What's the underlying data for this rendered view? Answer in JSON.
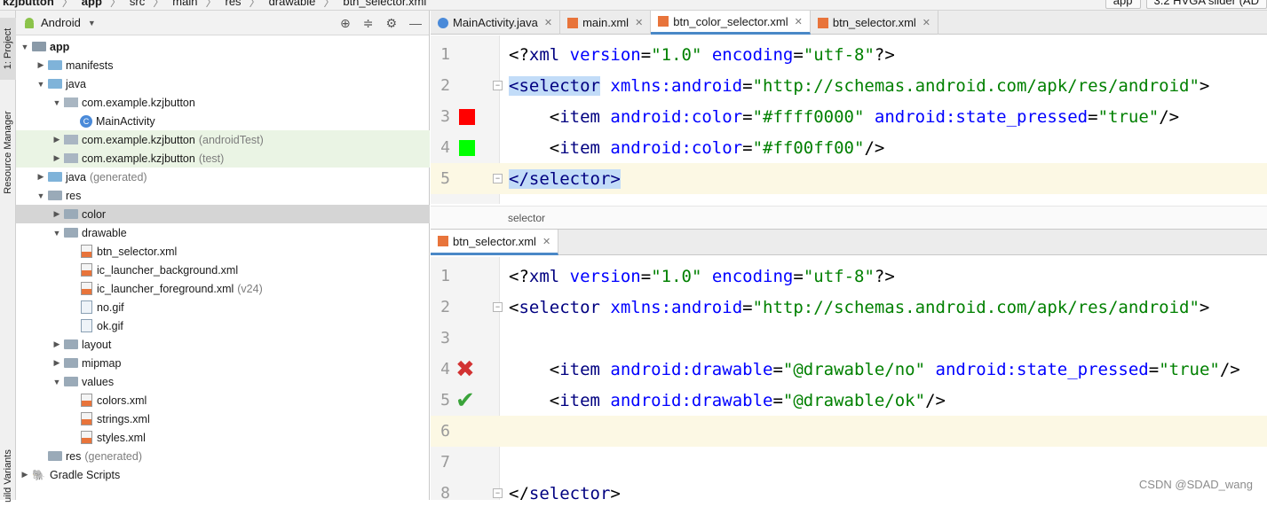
{
  "breadcrumb": {
    "items": [
      "kzjbutton",
      "app",
      "src",
      "main",
      "res",
      "drawable",
      "btn_selector.xml"
    ],
    "right": [
      "app",
      "3.2  HVGA slider (AD"
    ]
  },
  "left_strip": {
    "project_tab": "1: Project",
    "resource_manager_tab": "Resource Manager",
    "build_variants_tab": "uild Variants"
  },
  "project_panel": {
    "title": "Android",
    "tree": [
      {
        "label": "app",
        "extra": "",
        "type": "module",
        "depth": 0,
        "expanded": true
      },
      {
        "label": "manifests",
        "extra": "",
        "type": "folder-blue",
        "depth": 1,
        "expanded": false
      },
      {
        "label": "java",
        "extra": "",
        "type": "folder-blue",
        "depth": 1,
        "expanded": true
      },
      {
        "label": "com.example.kzjbutton",
        "extra": "",
        "type": "package",
        "depth": 2,
        "expanded": true
      },
      {
        "label": "MainActivity",
        "extra": "",
        "type": "class",
        "depth": 3,
        "expanded": null
      },
      {
        "label": "com.example.kzjbutton",
        "extra": "(androidTest)",
        "type": "package",
        "depth": 2,
        "expanded": false,
        "state": "test"
      },
      {
        "label": "com.example.kzjbutton",
        "extra": "(test)",
        "type": "package",
        "depth": 2,
        "expanded": false,
        "state": "test"
      },
      {
        "label": "java",
        "extra": "(generated)",
        "type": "folder-blue",
        "depth": 1,
        "expanded": false
      },
      {
        "label": "res",
        "extra": "",
        "type": "folder",
        "depth": 1,
        "expanded": true
      },
      {
        "label": "color",
        "extra": "",
        "type": "folder",
        "depth": 2,
        "expanded": false,
        "state": "selected"
      },
      {
        "label": "drawable",
        "extra": "",
        "type": "folder",
        "depth": 2,
        "expanded": true
      },
      {
        "label": "btn_selector.xml",
        "extra": "",
        "type": "xml",
        "depth": 3,
        "expanded": null
      },
      {
        "label": "ic_launcher_background.xml",
        "extra": "",
        "type": "xml",
        "depth": 3,
        "expanded": null
      },
      {
        "label": "ic_launcher_foreground.xml",
        "extra": "(v24)",
        "type": "xml",
        "depth": 3,
        "expanded": null
      },
      {
        "label": "no.gif",
        "extra": "",
        "type": "gif",
        "depth": 3,
        "expanded": null
      },
      {
        "label": "ok.gif",
        "extra": "",
        "type": "gif",
        "depth": 3,
        "expanded": null
      },
      {
        "label": "layout",
        "extra": "",
        "type": "folder",
        "depth": 2,
        "expanded": false
      },
      {
        "label": "mipmap",
        "extra": "",
        "type": "folder",
        "depth": 2,
        "expanded": false
      },
      {
        "label": "values",
        "extra": "",
        "type": "folder",
        "depth": 2,
        "expanded": true
      },
      {
        "label": "colors.xml",
        "extra": "",
        "type": "xml",
        "depth": 3,
        "expanded": null
      },
      {
        "label": "strings.xml",
        "extra": "",
        "type": "xml",
        "depth": 3,
        "expanded": null
      },
      {
        "label": "styles.xml",
        "extra": "",
        "type": "xml",
        "depth": 3,
        "expanded": null
      },
      {
        "label": "res",
        "extra": "(generated)",
        "type": "folder",
        "depth": 1,
        "expanded": null
      },
      {
        "label": "Gradle Scripts",
        "extra": "",
        "type": "gradle",
        "depth": 0,
        "expanded": false
      }
    ]
  },
  "editor_tabs": [
    {
      "label": "MainActivity.java",
      "icon": "java",
      "active": false
    },
    {
      "label": "main.xml",
      "icon": "xml",
      "active": false
    },
    {
      "label": "btn_color_selector.xml",
      "icon": "xml",
      "active": true
    },
    {
      "label": "btn_selector.xml",
      "icon": "xml",
      "active": false
    }
  ],
  "pane1": {
    "lines": [
      {
        "num": "1",
        "gutter": "",
        "segments": [
          [
            "t",
            "<?"
          ],
          [
            "tag",
            "xml"
          ],
          [
            "t",
            " "
          ],
          [
            "attr",
            "version"
          ],
          [
            "t",
            "="
          ],
          [
            "val",
            "\"1.0\""
          ],
          [
            "t",
            " "
          ],
          [
            "attr",
            "encoding"
          ],
          [
            "t",
            "="
          ],
          [
            "val",
            "\"utf-8\""
          ],
          [
            "t",
            "?>"
          ]
        ]
      },
      {
        "num": "2",
        "gutter": "fold",
        "segments": [
          [
            "hl",
            "<selector"
          ],
          [
            "t",
            " "
          ],
          [
            "attr",
            "xmlns:android"
          ],
          [
            "t",
            "="
          ],
          [
            "val",
            "\"http://schemas.android.com/apk/res/android\""
          ],
          [
            "t",
            ">"
          ]
        ]
      },
      {
        "num": "3",
        "gutter": "swatch:#ff0000",
        "segments": [
          [
            "t",
            "    <"
          ],
          [
            "tag",
            "item"
          ],
          [
            "t",
            " "
          ],
          [
            "attr",
            "android:color"
          ],
          [
            "t",
            "="
          ],
          [
            "val",
            "\"#ffff0000\""
          ],
          [
            "t",
            " "
          ],
          [
            "attr",
            "android:state_pressed"
          ],
          [
            "t",
            "="
          ],
          [
            "val",
            "\"true\""
          ],
          [
            "t",
            "/>"
          ]
        ]
      },
      {
        "num": "4",
        "gutter": "swatch:#00ff00",
        "segments": [
          [
            "t",
            "    <"
          ],
          [
            "tag",
            "item"
          ],
          [
            "t",
            " "
          ],
          [
            "attr",
            "android:color"
          ],
          [
            "t",
            "="
          ],
          [
            "val",
            "\"#ff00ff00\""
          ],
          [
            "t",
            "/>"
          ]
        ]
      },
      {
        "num": "5",
        "gutter": "fold",
        "current": true,
        "segments": [
          [
            "hl",
            "</selector>"
          ]
        ]
      }
    ],
    "breadcrumb": "selector"
  },
  "pane2_tab": "btn_selector.xml",
  "pane2": {
    "lines": [
      {
        "num": "1",
        "gutter": "",
        "segments": [
          [
            "t",
            "<?"
          ],
          [
            "tag",
            "xml"
          ],
          [
            "t",
            " "
          ],
          [
            "attr",
            "version"
          ],
          [
            "t",
            "="
          ],
          [
            "val",
            "\"1.0\""
          ],
          [
            "t",
            " "
          ],
          [
            "attr",
            "encoding"
          ],
          [
            "t",
            "="
          ],
          [
            "val",
            "\"utf-8\""
          ],
          [
            "t",
            "?>"
          ]
        ]
      },
      {
        "num": "2",
        "gutter": "fold",
        "segments": [
          [
            "t",
            "<"
          ],
          [
            "tag",
            "selector"
          ],
          [
            "t",
            " "
          ],
          [
            "attr",
            "xmlns:android"
          ],
          [
            "t",
            "="
          ],
          [
            "val",
            "\"http://schemas.android.com/apk/res/android\""
          ],
          [
            "t",
            ">"
          ]
        ]
      },
      {
        "num": "3",
        "gutter": "",
        "segments": []
      },
      {
        "num": "4",
        "gutter": "xmark",
        "segments": [
          [
            "t",
            "    <"
          ],
          [
            "tag",
            "item"
          ],
          [
            "t",
            " "
          ],
          [
            "attr",
            "android:drawable"
          ],
          [
            "t",
            "="
          ],
          [
            "val",
            "\"@drawable/no\""
          ],
          [
            "t",
            " "
          ],
          [
            "attr",
            "android:state_pressed"
          ],
          [
            "t",
            "="
          ],
          [
            "val",
            "\"true\""
          ],
          [
            "t",
            "/>"
          ]
        ]
      },
      {
        "num": "5",
        "gutter": "check",
        "segments": [
          [
            "t",
            "    <"
          ],
          [
            "tag",
            "item"
          ],
          [
            "t",
            " "
          ],
          [
            "attr",
            "android:drawable"
          ],
          [
            "t",
            "="
          ],
          [
            "val",
            "\"@drawable/ok\""
          ],
          [
            "t",
            "/>"
          ]
        ]
      },
      {
        "num": "6",
        "gutter": "",
        "current": true,
        "segments": []
      },
      {
        "num": "7",
        "gutter": "",
        "segments": []
      },
      {
        "num": "8",
        "gutter": "fold",
        "segments": [
          [
            "t",
            "</"
          ],
          [
            "tag",
            "selector"
          ],
          [
            "t",
            ">"
          ]
        ]
      }
    ]
  },
  "watermark": "CSDN @SDAD_wang",
  "colors": {
    "accent": "#4a88c7",
    "selection": "#c2dcf8",
    "current_line": "#fcf8e4"
  }
}
